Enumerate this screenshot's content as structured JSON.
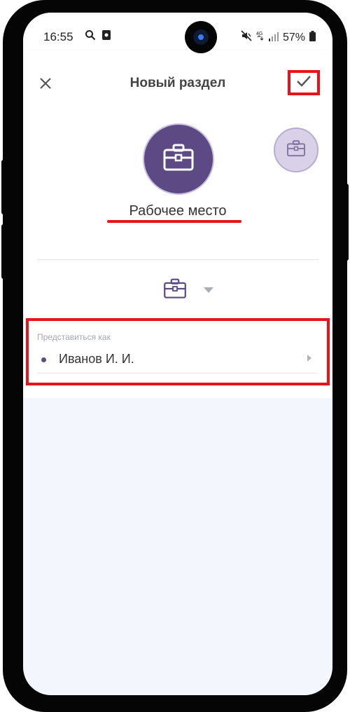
{
  "status_bar": {
    "time": "16:55",
    "battery": "57%",
    "left_icons": [
      "search-icon",
      "notification-icon"
    ],
    "right_icons": [
      "mute-icon",
      "4g-icon",
      "signal-icon",
      "battery-icon"
    ]
  },
  "toolbar": {
    "title": "Новый раздел",
    "close_icon": "close-icon",
    "confirm_icon": "check-icon"
  },
  "section": {
    "name": "Рабочее место",
    "icon": "briefcase-icon",
    "avatar_color": "#5d4a84",
    "avatar_alt_color": "#d8d1e8"
  },
  "profile": {
    "label": "Представиться как",
    "name": "Иванов И. И."
  },
  "colors": {
    "accent": "#5d4a84",
    "highlight": "#e8121a",
    "background": "#f3f6fc"
  }
}
